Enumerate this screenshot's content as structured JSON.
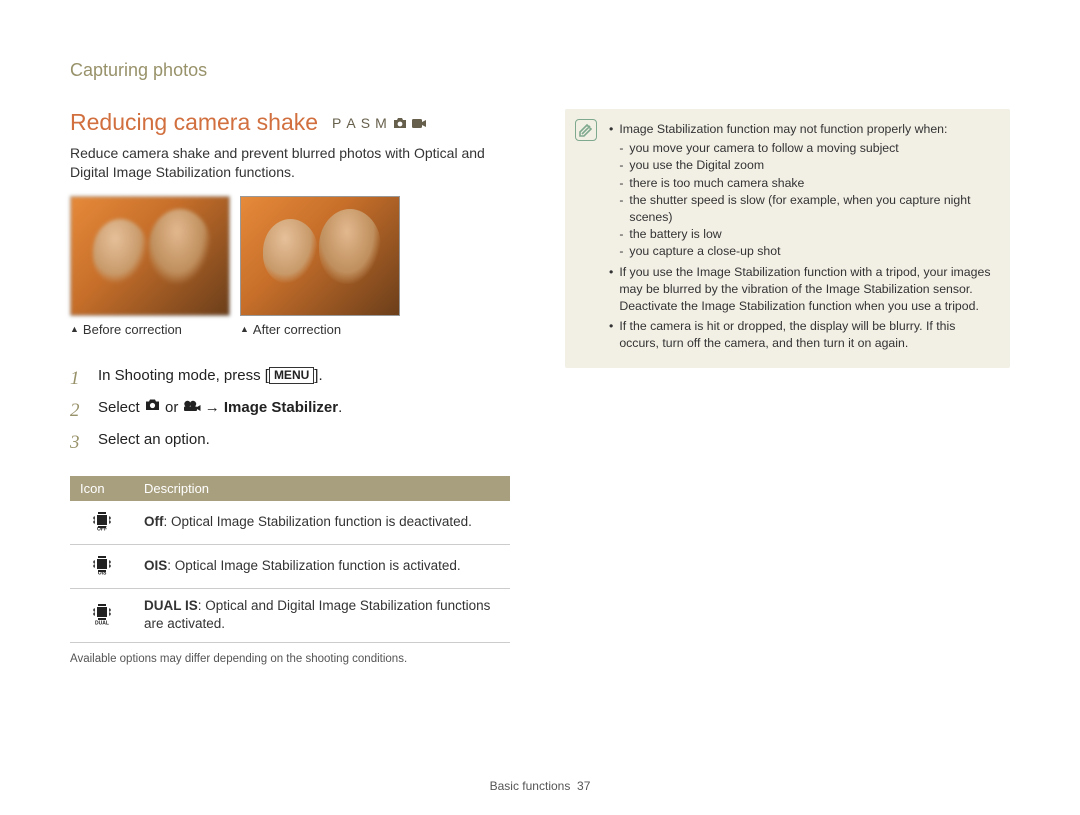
{
  "section_label": "Capturing photos",
  "heading": "Reducing camera shake",
  "mode_letters": [
    "P",
    "A",
    "S",
    "M"
  ],
  "intro": "Reduce camera shake and prevent blurred photos with Optical and Digital Image Stabilization functions.",
  "captions": {
    "before": "Before correction",
    "after": "After correction"
  },
  "steps": {
    "s1_pre": "In Shooting mode, press [",
    "s1_menu": "MENU",
    "s1_post": "].",
    "s2_pre": "Select ",
    "s2_mid": " or ",
    "s2_arrow": " → ",
    "s2_bold": "Image Stabilizer",
    "s2_post": ".",
    "s3": "Select an option."
  },
  "table": {
    "h_icon": "Icon",
    "h_desc": "Description",
    "rows": [
      {
        "icon": "OFF",
        "bold": "Off",
        "rest": ": Optical Image Stabilization function is deactivated."
      },
      {
        "icon": "OIS",
        "bold": "OIS",
        "rest": ": Optical Image Stabilization function is activated."
      },
      {
        "icon": "DUAL",
        "bold": "DUAL IS",
        "rest": ": Optical and Digital Image Stabilization functions are activated."
      }
    ]
  },
  "footnote": "Available options may differ depending on the shooting conditions.",
  "note": {
    "lead": "Image Stabilization function may not function properly when:",
    "sub": [
      "you move your camera to follow a moving subject",
      "you use the Digital zoom",
      "there is too much camera shake",
      "the shutter speed is slow (for example, when you capture night scenes)",
      "the battery is low",
      "you capture a close-up shot"
    ],
    "b2": "If you use the Image Stabilization function with a tripod, your images may be blurred by the vibration of the Image Stabilization sensor. Deactivate the Image Stabilization function when you use a tripod.",
    "b3": "If the camera is hit or dropped, the display will be blurry. If this occurs, turn off the camera, and then turn it on again."
  },
  "footer": {
    "label": "Basic functions",
    "page": "37"
  }
}
